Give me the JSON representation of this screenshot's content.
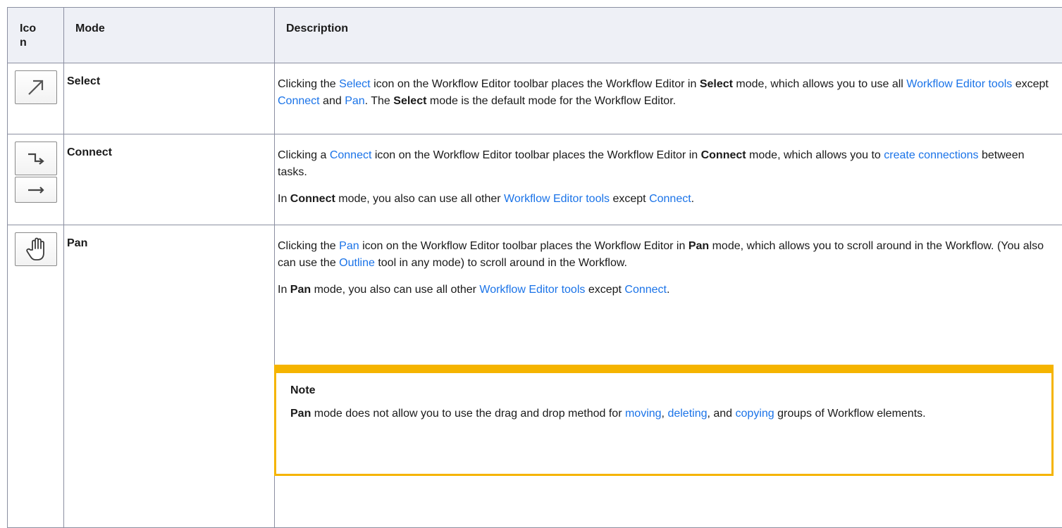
{
  "table": {
    "headers": {
      "icon": "Ico n",
      "mode": "Mode",
      "description": "Description"
    },
    "rows": [
      {
        "mode": "Select",
        "desc": {
          "t1": "Clicking the ",
          "l1": "Select",
          "t2": " icon on the Workflow Editor toolbar places the Workflow Editor in ",
          "b1": "Select",
          "t3": " mode, which allows you to use all ",
          "l2": "Workflow Editor tools",
          "t4": " except ",
          "l3": "Connect",
          "t5": " and ",
          "l4": "Pan",
          "t6": ". The ",
          "b2": "Select",
          "t7": " mode is the default mode for the Workflow Editor."
        }
      },
      {
        "mode": "Connect",
        "desc": {
          "t1": "Clicking a ",
          "l1": "Connect",
          "t2": " icon on the Workflow Editor toolbar places the Workflow Editor in ",
          "b1": "Connect",
          "t3": " mode, which allows you to ",
          "l2": "create connections",
          "t4": " between tasks."
        },
        "desc2": {
          "t1": "In ",
          "b1": "Connect",
          "t2": " mode, you also can use all other ",
          "l1": "Workflow Editor tools",
          "t3": " except ",
          "l2": "Connect",
          "t4": "."
        }
      },
      {
        "mode": "Pan",
        "desc": {
          "t1": "Clicking the ",
          "l1": "Pan",
          "t2": " icon on the Workflow Editor toolbar places the Workflow Editor in ",
          "b1": "Pan",
          "t3": " mode, which allows you to scroll around in the Workflow. (You also can use the ",
          "l2": "Outline",
          "t4": " tool in any mode) to scroll around in the Workflow."
        },
        "desc2": {
          "t1": "In ",
          "b1": "Pan",
          "t2": " mode, you also can use all other ",
          "l1": "Workflow Editor tools",
          "t3": " except ",
          "l2": "Connect",
          "t4": "."
        },
        "note": {
          "title": "Note",
          "b1": "Pan",
          "t1": " mode does not allow you to use the drag and drop method for ",
          "l1": "moving",
          "t2": ", ",
          "l2": "deleting",
          "t3": ", and ",
          "l3": "copying",
          "t4": " groups of Workflow elements."
        }
      }
    ]
  },
  "icons": {
    "select": "select-arrow-icon",
    "connect_elbow": "connect-elbow-arrow-icon",
    "connect_straight": "connect-straight-arrow-icon",
    "pan": "pan-hand-icon"
  },
  "colors": {
    "link": "#1a73e8",
    "header_bg": "#eef0f6",
    "border": "#8b8fa1",
    "note_border": "#f5b400"
  }
}
